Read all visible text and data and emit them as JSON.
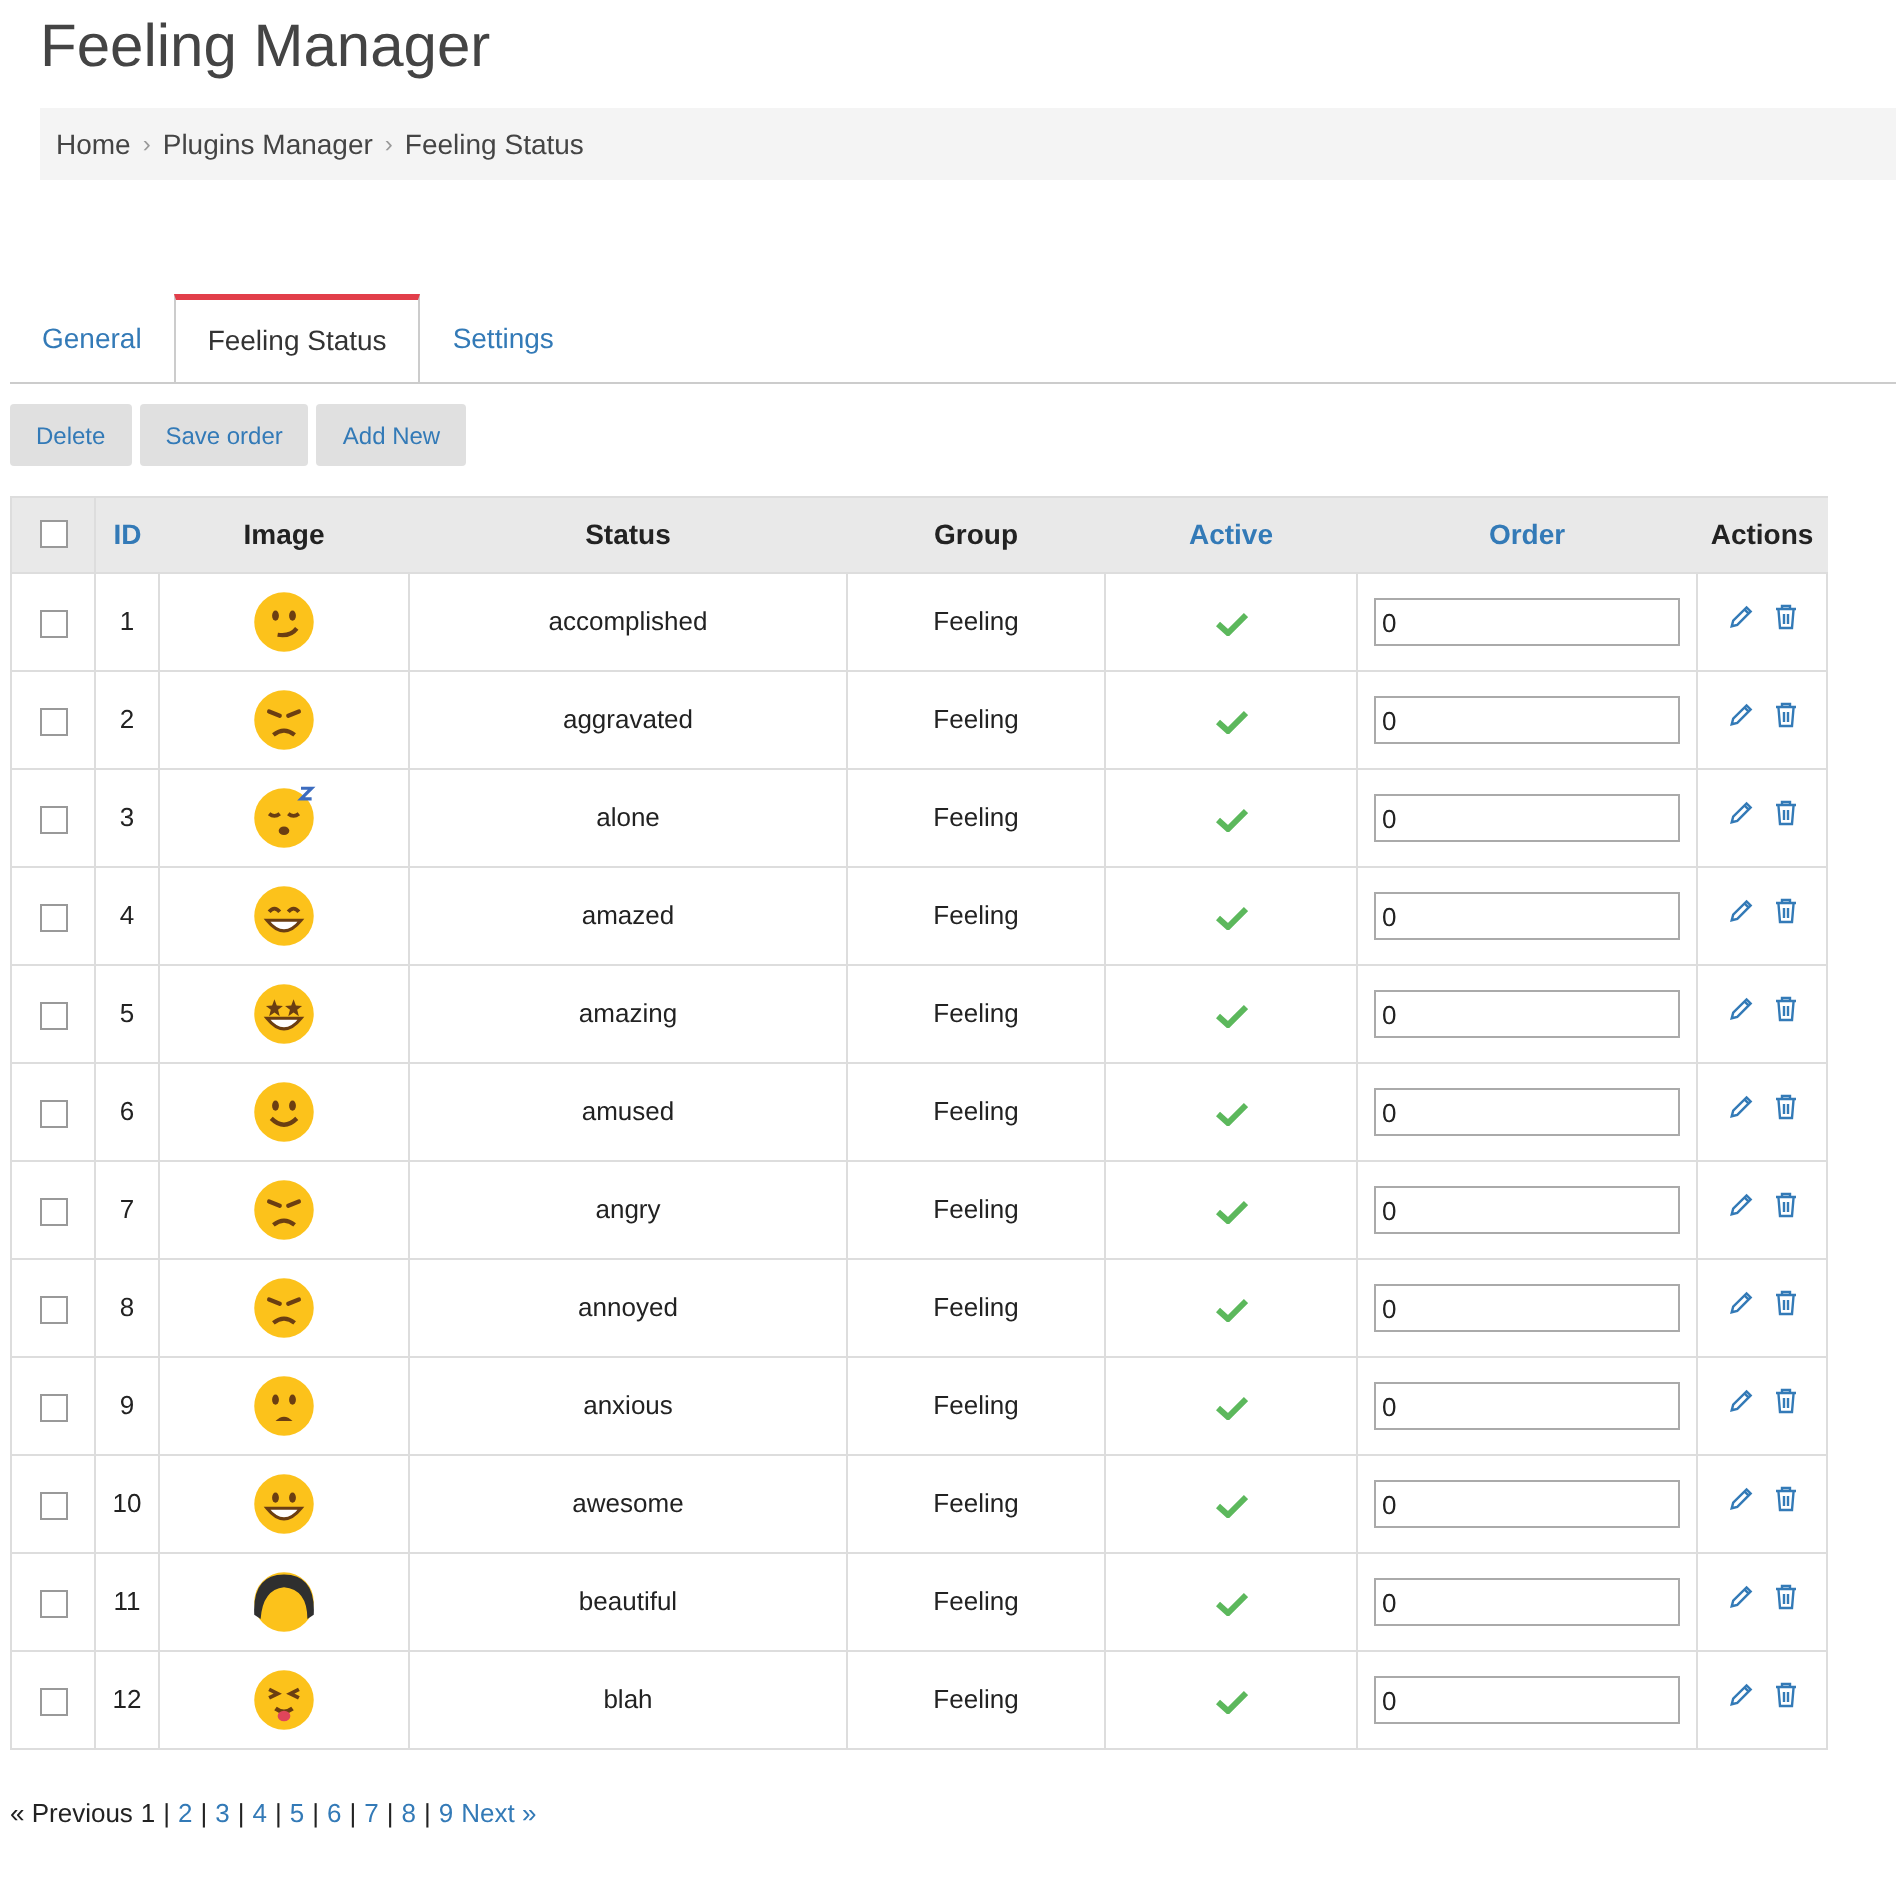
{
  "page_title": "Feeling Manager",
  "breadcrumb": {
    "items": [
      "Home",
      "Plugins Manager",
      "Feeling Status"
    ],
    "separator": "›"
  },
  "tabs": [
    {
      "label": "General",
      "selected": false
    },
    {
      "label": "Feeling Status",
      "selected": true
    },
    {
      "label": "Settings",
      "selected": false
    }
  ],
  "buttons": [
    "Delete",
    "Save order",
    "Add New"
  ],
  "table": {
    "select_all_checked": false,
    "columns": [
      {
        "label": "ID",
        "sortable": true
      },
      {
        "label": "Image",
        "sortable": false
      },
      {
        "label": "Status",
        "sortable": false
      },
      {
        "label": "Group",
        "sortable": false
      },
      {
        "label": "Active",
        "sortable": true
      },
      {
        "label": "Order",
        "sortable": true
      },
      {
        "label": "Actions",
        "sortable": false
      }
    ],
    "rows": [
      {
        "checked": false,
        "id": "1",
        "status": "accomplished",
        "group": "Feeling",
        "active": true,
        "order": "0"
      },
      {
        "checked": false,
        "id": "2",
        "status": "aggravated",
        "group": "Feeling",
        "active": true,
        "order": "0"
      },
      {
        "checked": false,
        "id": "3",
        "status": "alone",
        "group": "Feeling",
        "active": true,
        "order": "0"
      },
      {
        "checked": false,
        "id": "4",
        "status": "amazed",
        "group": "Feeling",
        "active": true,
        "order": "0"
      },
      {
        "checked": false,
        "id": "5",
        "status": "amazing",
        "group": "Feeling",
        "active": true,
        "order": "0"
      },
      {
        "checked": false,
        "id": "6",
        "status": "amused",
        "group": "Feeling",
        "active": true,
        "order": "0"
      },
      {
        "checked": false,
        "id": "7",
        "status": "angry",
        "group": "Feeling",
        "active": true,
        "order": "0"
      },
      {
        "checked": false,
        "id": "8",
        "status": "annoyed",
        "group": "Feeling",
        "active": true,
        "order": "0"
      },
      {
        "checked": false,
        "id": "9",
        "status": "anxious",
        "group": "Feeling",
        "active": true,
        "order": "0"
      },
      {
        "checked": false,
        "id": "10",
        "status": "awesome",
        "group": "Feeling",
        "active": true,
        "order": "0"
      },
      {
        "checked": false,
        "id": "11",
        "status": "beautiful",
        "group": "Feeling",
        "active": true,
        "order": "0"
      },
      {
        "checked": false,
        "id": "12",
        "status": "blah",
        "group": "Feeling",
        "active": true,
        "order": "0"
      }
    ]
  },
  "pagination": {
    "previous": {
      "label": "« Previous",
      "disabled": true
    },
    "next": {
      "label": "Next »",
      "disabled": false
    },
    "separator": "|",
    "pages": [
      {
        "label": "1",
        "selected": true
      },
      {
        "label": "2",
        "selected": false
      },
      {
        "label": "3",
        "selected": false
      },
      {
        "label": "4",
        "selected": false
      },
      {
        "label": "5",
        "selected": false
      },
      {
        "label": "6",
        "selected": false
      },
      {
        "label": "7",
        "selected": false
      },
      {
        "label": "8",
        "selected": false
      },
      {
        "label": "9",
        "selected": false
      }
    ]
  }
}
